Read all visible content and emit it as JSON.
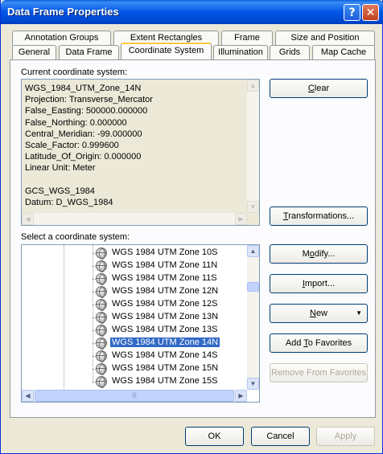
{
  "window": {
    "title": "Data Frame Properties",
    "help_glyph": "?",
    "close_glyph": "✕"
  },
  "tabs_row1": [
    "Annotation Groups",
    "Extent Rectangles",
    "Frame",
    "Size and Position"
  ],
  "tabs_row2": [
    "General",
    "Data Frame",
    "Coordinate System",
    "Illumination",
    "Grids",
    "Map Cache"
  ],
  "active_tab": "Coordinate System",
  "current_cs": {
    "label": "Current coordinate system:",
    "text": "WGS_1984_UTM_Zone_14N\nProjection: Transverse_Mercator\nFalse_Easting: 500000.000000\nFalse_Northing: 0.000000\nCentral_Meridian: -99.000000\nScale_Factor: 0.999600\nLatitude_Of_Origin: 0.000000\nLinear Unit: Meter\n\nGCS_WGS_1984\nDatum: D_WGS_1984"
  },
  "select_cs": {
    "label": "Select a coordinate system:",
    "items": [
      "WGS 1984 UTM Zone 10S",
      "WGS 1984 UTM Zone 11N",
      "WGS 1984 UTM Zone 11S",
      "WGS 1984 UTM Zone 12N",
      "WGS 1984 UTM Zone 12S",
      "WGS 1984 UTM Zone 13N",
      "WGS 1984 UTM Zone 13S",
      "WGS 1984 UTM Zone 14N",
      "WGS 1984 UTM Zone 14S",
      "WGS 1984 UTM Zone 15N",
      "WGS 1984 UTM Zone 15S"
    ],
    "selected": "WGS 1984 UTM Zone 14N"
  },
  "buttons": {
    "clear_u": "C",
    "clear_rest": "lear",
    "transform_u": "T",
    "transform_rest": "ransformations...",
    "modify_pre": "M",
    "modify_u": "o",
    "modify_rest": "dify...",
    "import_u": "I",
    "import_rest": "mport...",
    "new_u": "N",
    "new_rest": "ew",
    "add_fav_pre": "Add ",
    "add_fav_u": "T",
    "add_fav_rest": "o Favorites",
    "remove_fav": "Remove From Favorites",
    "ok": "OK",
    "cancel": "Cancel",
    "apply": "Apply"
  },
  "icons": {
    "scroll_left": "◀",
    "scroll_right": "▶",
    "scroll_up": "▲",
    "scroll_down": "▼",
    "dropdown": "▼",
    "grip": "|||",
    "globe": "globe-icon"
  }
}
